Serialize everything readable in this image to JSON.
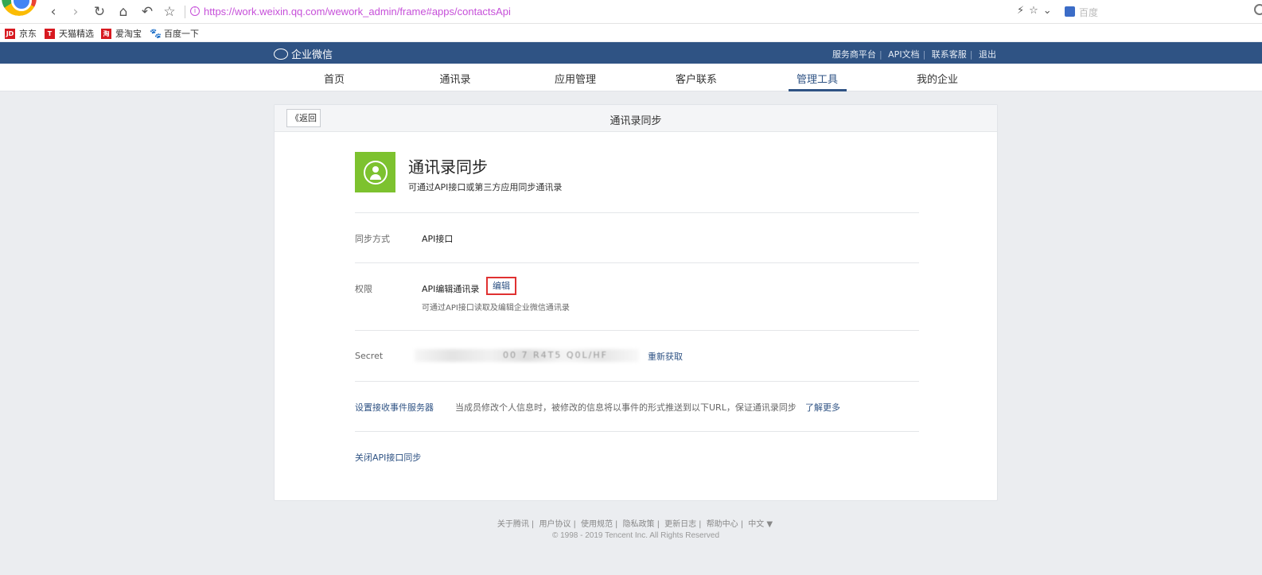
{
  "browser": {
    "url": "https://work.weixin.qq.com/wework_admin/frame#apps/contactsApi",
    "search_placeholder": "百度"
  },
  "bookmarks": [
    {
      "icon_text": "JD",
      "label": "京东",
      "color": "#d71920"
    },
    {
      "icon_text": "T",
      "label": "天猫精选",
      "color": "#d71920"
    },
    {
      "icon_text": "淘",
      "label": "爱淘宝",
      "color": "#d71920"
    },
    {
      "icon_text": "",
      "label": "百度一下",
      "color": "#2d6be0"
    }
  ],
  "header": {
    "brand": "企业微信",
    "links": [
      "服务商平台",
      "API文档",
      "联系客服",
      "退出"
    ]
  },
  "nav": {
    "items": [
      "首页",
      "通讯录",
      "应用管理",
      "客户联系",
      "管理工具",
      "我的企业"
    ],
    "active": "管理工具"
  },
  "panel": {
    "back_label": "《返回",
    "title": "通讯录同步",
    "app_title": "通讯录同步",
    "app_desc": "可通过API接口或第三方应用同步通讯录",
    "sync_mode_label": "同步方式",
    "sync_mode_value": "API接口",
    "permission_label": "权限",
    "permission_value": "API编辑通讯录",
    "permission_edit": "编辑",
    "permission_desc": "可通过API接口读取及编辑企业微信通讯录",
    "secret_label": "Secret",
    "secret_visible_fragment": "00 7    R4T5  Q0L/HF",
    "secret_refresh": "重新获取",
    "event_server_link": "设置接收事件服务器",
    "event_desc": "当成员修改个人信息时，被修改的信息将以事件的形式推送到以下URL，保证通讯录同步",
    "learn_more": "了解更多",
    "close_api": "关闭API接口同步"
  },
  "footer": {
    "links": [
      "关于腾讯",
      "用户协议",
      "使用规范",
      "隐私政策",
      "更新日志",
      "帮助中心",
      "中文 ▼"
    ],
    "copyright": "© 1998 - 2019 Tencent Inc. All Rights Reserved"
  },
  "colors": {
    "header_bg": "#2f5384",
    "accent": "#2f5384",
    "app_icon": "#7dc22f",
    "highlight_border": "#e03131"
  }
}
